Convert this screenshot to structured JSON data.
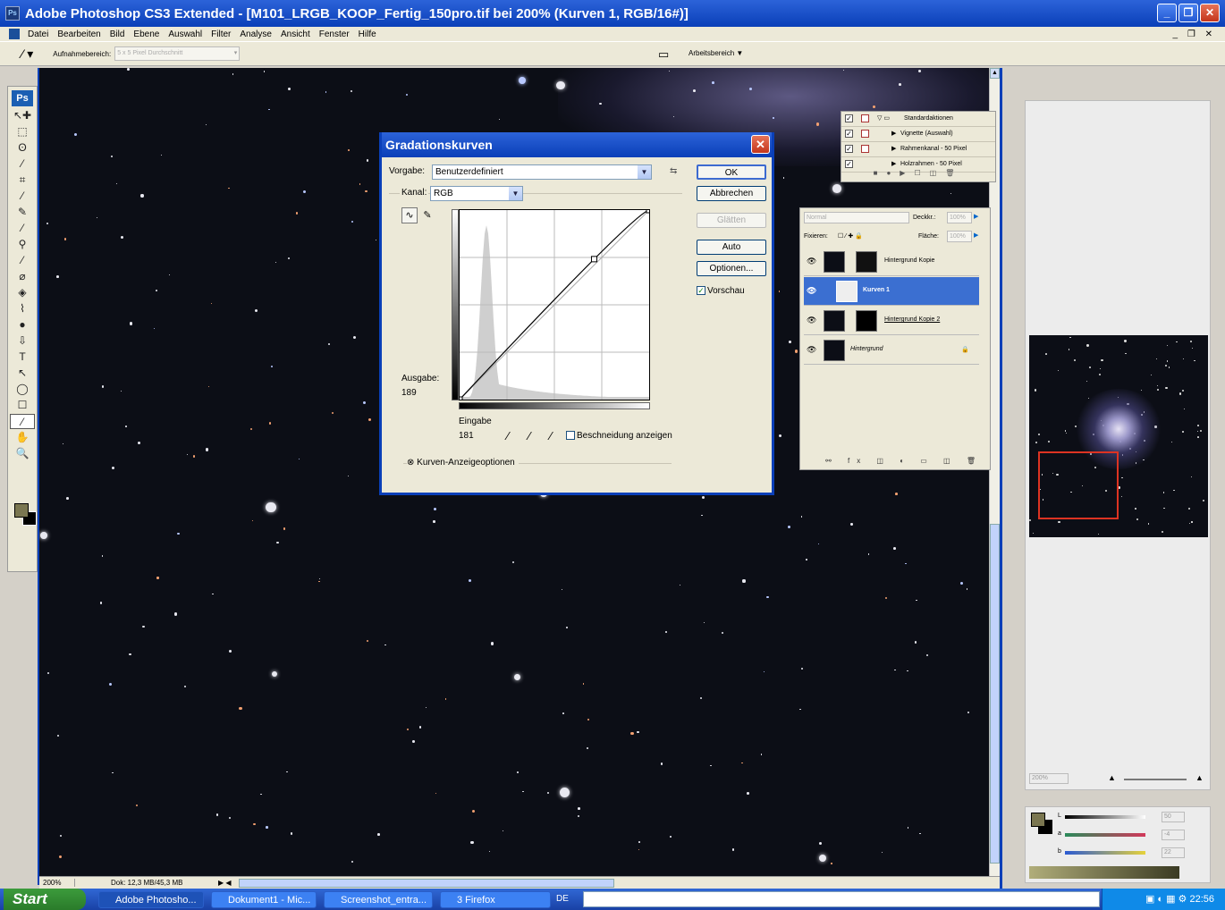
{
  "window": {
    "title": "Adobe Photoshop CS3 Extended - [M101_LRGB_KOOP_Fertig_150pro.tif bei 200% (Kurven 1, RGB/16#)]",
    "controls": [
      "_",
      "❐",
      "✕"
    ],
    "mdi_controls": "_ ❐ ✕"
  },
  "menu": [
    "Datei",
    "Bearbeiten",
    "Bild",
    "Ebene",
    "Auswahl",
    "Filter",
    "Analyse",
    "Ansicht",
    "Fenster",
    "Hilfe"
  ],
  "options": {
    "sample_label": "Aufnahmebereich:",
    "sample_value": "5 x 5 Pixel Durchschnitt",
    "workspace_label": "Arbeitsbereich ▼"
  },
  "toolbox": {
    "logo": "Ps",
    "tools": [
      "↖✚",
      "⬚",
      "ʘ",
      "⁄",
      "⌗",
      "⁄",
      "✎",
      "⁄",
      "⚲",
      "⁄",
      "⌀",
      "◈",
      "⌇",
      "●",
      "⇩",
      "T",
      "↖",
      "◯",
      "☐",
      "⁄",
      "✋",
      "🔍"
    ]
  },
  "curves": {
    "title": "Gradationskurven",
    "preset_label": "Vorgabe:",
    "preset_value": "Benutzerdefiniert",
    "channel_label": "Kanal:",
    "channel_value": "RGB",
    "output_label": "Ausgabe:",
    "output_value": "189",
    "input_label": "Eingabe",
    "input_value": "181",
    "clipping_label": "Beschneidung anzeigen",
    "display_options": "Kurven-Anzeigeoptionen",
    "buttons": {
      "ok": "OK",
      "cancel": "Abbrechen",
      "smooth": "Glätten",
      "auto": "Auto",
      "options": "Optionen...",
      "preview": "Vorschau"
    },
    "curve_points": [
      [
        0,
        0
      ],
      [
        181,
        189
      ],
      [
        255,
        255
      ]
    ]
  },
  "actions": [
    {
      "label": "Standardaktionen"
    },
    {
      "label": "Vignette (Auswahl)"
    },
    {
      "label": "Rahmenkanal - 50 Pixel"
    },
    {
      "label": "Holzrahmen - 50 Pixel"
    }
  ],
  "layers": {
    "blend_mode": "Normal",
    "opacity_label": "Deckkr.:",
    "opacity_value": "100%",
    "lock_label": "Fixieren:",
    "fill_label": "Fläche:",
    "fill_value": "100%",
    "items": [
      {
        "name": "Hintergrund Kopie"
      },
      {
        "name": "Kurven 1"
      },
      {
        "name": "Hintergrund Kopie 2"
      },
      {
        "name": "Hintergrund"
      }
    ]
  },
  "navigator": {
    "zoom": "200%"
  },
  "color": {
    "labels": [
      "L",
      "a",
      "b"
    ],
    "values": [
      "50",
      "-4",
      "22"
    ]
  },
  "status": {
    "zoom": "200%",
    "doc": "Dok: 12,3 MB/45,3 MB"
  },
  "taskbar": {
    "start": "Start",
    "tasks": [
      "Adobe Photosho...",
      "Dokument1 - Mic...",
      "Screenshot_entra...",
      "3 Firefox"
    ],
    "lang": "DE",
    "time": "22:56"
  }
}
